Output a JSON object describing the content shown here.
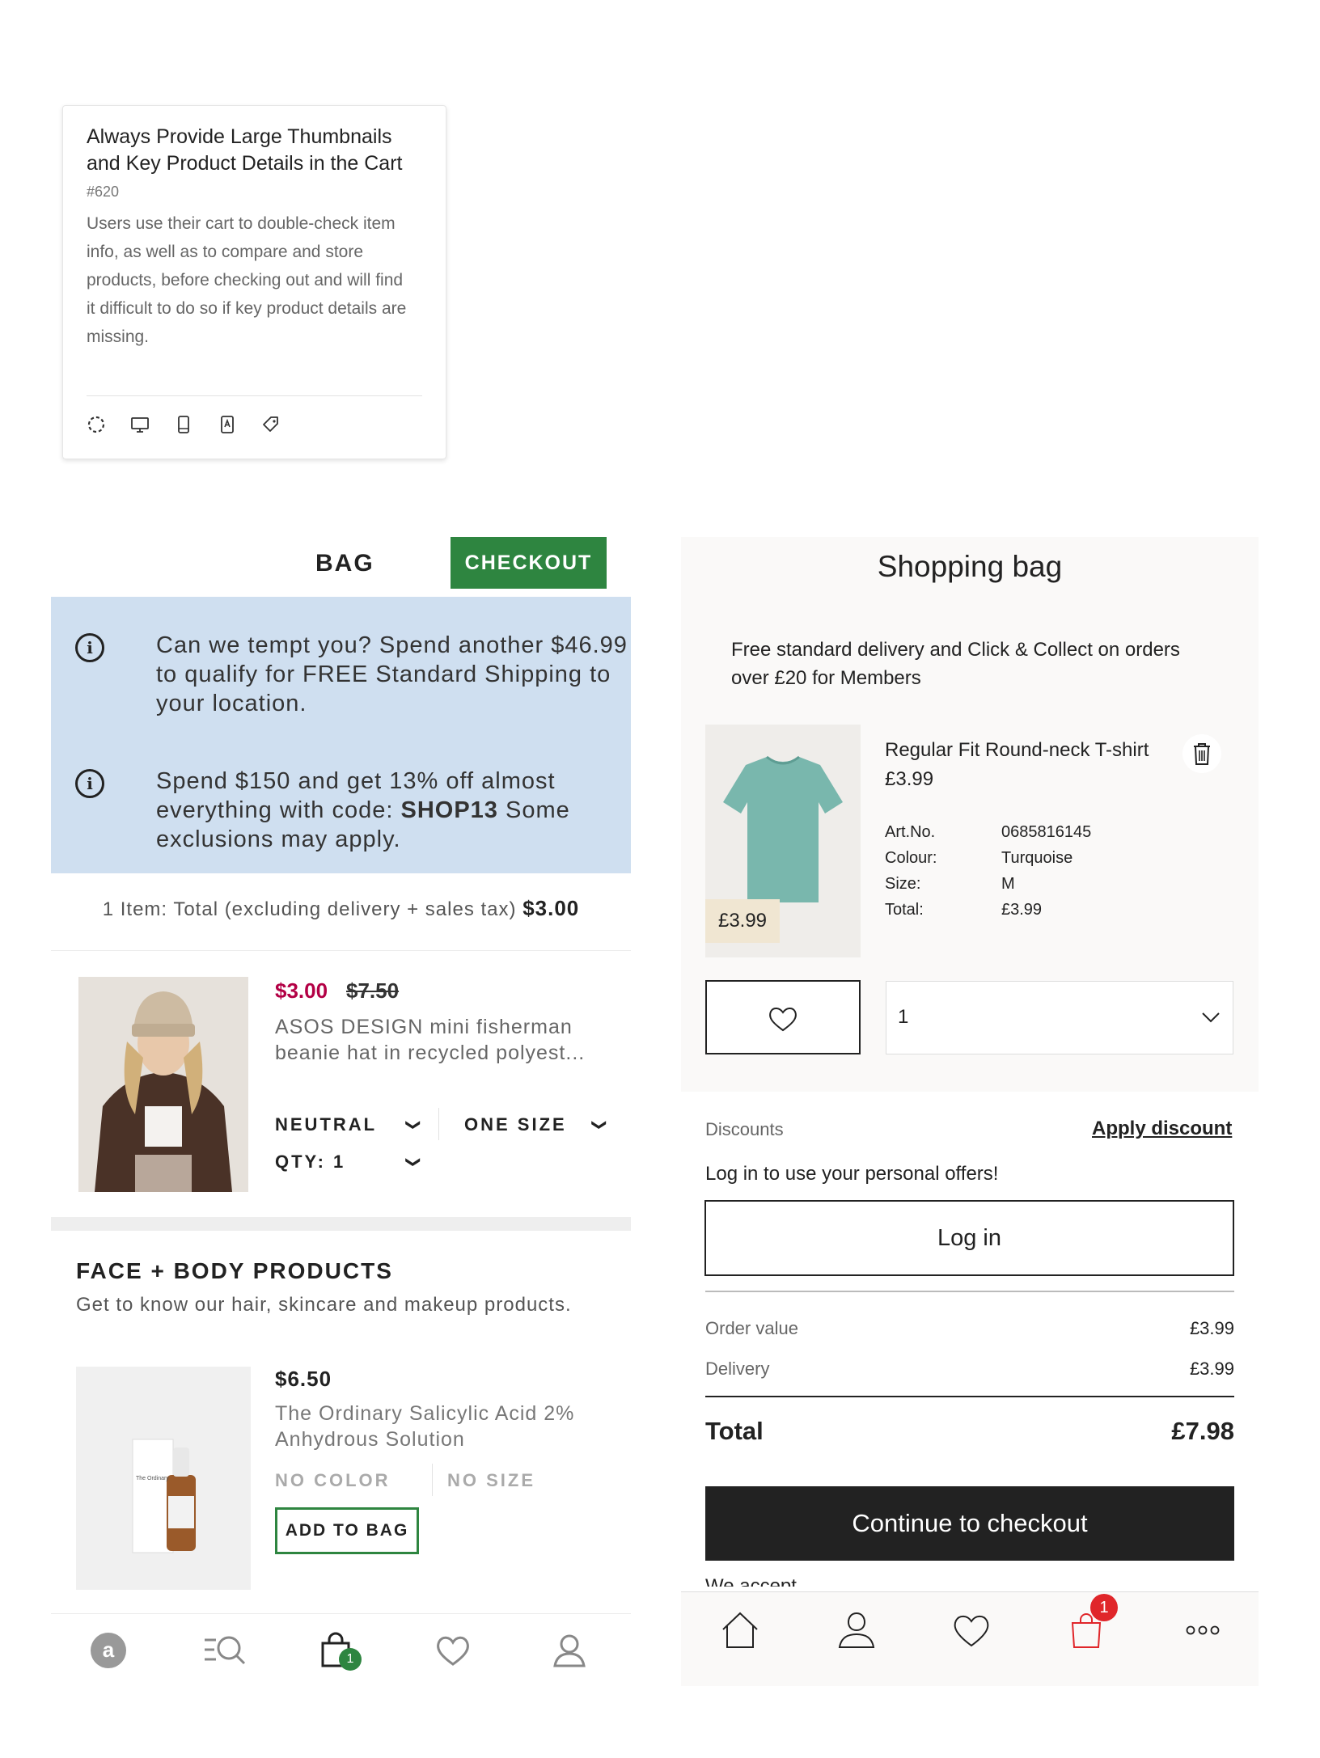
{
  "card": {
    "title": "Always Provide Large Thumbnails and Key Product Details in the Cart",
    "number": "#620",
    "description": "Users use their cart to double-check item info, as well as to compare and store products, before checking out and will find it difficult to do so if key product details are missing.",
    "icons": [
      "dashed-circle-icon",
      "desktop-icon",
      "mobile-icon",
      "app-icon",
      "tag-icon"
    ]
  },
  "asos": {
    "header_title": "BAG",
    "checkout_label": "CHECKOUT",
    "promo1": "Can we tempt you? Spend another $46.99 to qualify for FREE Standard Shipping to your location.",
    "promo2_pre": "Spend $150 and get 13% off almost everything with code: ",
    "promo2_code": "SHOP13",
    "promo2_post": " Some exclusions may apply.",
    "total_label": "1 Item: Total (excluding delivery + sales tax) ",
    "total_value": "$3.00",
    "item": {
      "price_sale": "$3.00",
      "price_old": "$7.50",
      "name": "ASOS DESIGN mini fisherman beanie hat in recycled polyest...",
      "colour": "NEUTRAL",
      "size": "ONE SIZE",
      "qty": "QTY: 1"
    },
    "section_title": "FACE + BODY PRODUCTS",
    "section_subtitle": "Get to know our hair, skincare and makeup products.",
    "rec": {
      "price": "$6.50",
      "name": "The Ordinary Salicylic Acid 2% Anhydrous Solution",
      "colour": "NO COLOR",
      "size": "NO SIZE",
      "add_label": "ADD TO BAG",
      "bottle_label": "The Ordinary"
    },
    "nav": [
      "asos-logo-icon",
      "search-menu-icon",
      "bag-icon",
      "heart-icon",
      "account-icon"
    ],
    "bag_badge": "1",
    "accent": "#2e8540",
    "sale_color": "#b30045",
    "promo_bg": "#cfdff0"
  },
  "hm": {
    "title": "Shopping bag",
    "promo": "Free standard delivery and Click & Collect on orders over £20 for Members",
    "image_price": "£3.99",
    "product_name": "Regular Fit Round-neck T-shirt",
    "product_price": "£3.99",
    "specs": [
      {
        "label": "Art.No.",
        "value": "0685816145"
      },
      {
        "label": "Colour:",
        "value": "Turquoise"
      },
      {
        "label": "Size:",
        "value": "M"
      },
      {
        "label": "Total:",
        "value": "£3.99"
      }
    ],
    "qty_value": "1",
    "discounts_label": "Discounts",
    "apply_discount": "Apply discount",
    "login_msg": "Log in to use your personal offers!",
    "login_label": "Log in",
    "order_value_label": "Order value",
    "order_value": "£3.99",
    "delivery_label": "Delivery",
    "delivery_value": "£3.99",
    "total_label": "Total",
    "total_value": "£7.98",
    "cta_label": "Continue to checkout",
    "cut_text": "We accept",
    "nav": [
      "home-icon",
      "account-icon",
      "heart-icon",
      "bag-icon",
      "more-icon"
    ],
    "bag_badge": "1",
    "badge_color": "#e0262a"
  }
}
